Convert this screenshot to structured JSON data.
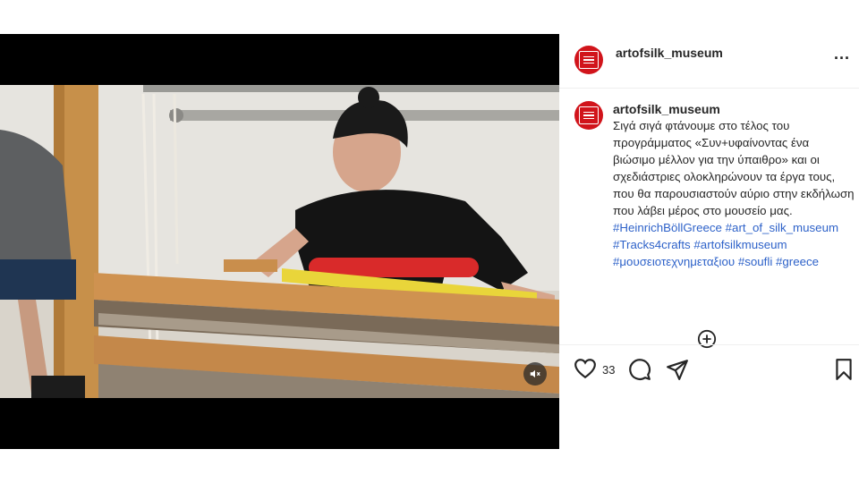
{
  "post": {
    "username": "artofsilk_museum",
    "more_label": "...",
    "caption": {
      "author": "artofsilk_museum",
      "text": "Σιγά σιγά φτάνουμε στο τέλος του προγράμματος «Συν+υφαίνοντας ένα βιώσιμο μέλλον για την ύπαιθρο» και οι σχεδιάστριες ολοκληρώνουν τα έργα τους, που θα παρουσιαστούν αύριο στην εκδήλωση που λάβει μέρος στο μουσείο μας.",
      "hashtags": [
        "#HeinrichBöllGreece",
        "#art_of_silk_museum",
        "#Tracks4crafts",
        "#artofsilkmuseum",
        "#μουσειοτεχνημεταξιου",
        "#soufli",
        "#greece"
      ]
    },
    "likes_count": "33",
    "icons": {
      "like": "heart-icon",
      "comment": "comment-icon",
      "share": "share-icon",
      "save": "bookmark-icon",
      "add_comment": "plus-circle-icon",
      "mute": "speaker-muted-icon",
      "avatar": "museum-logo"
    },
    "colors": {
      "avatar_bg": "#d1141b",
      "hashtag": "#2e62c9",
      "text": "#262626"
    }
  }
}
